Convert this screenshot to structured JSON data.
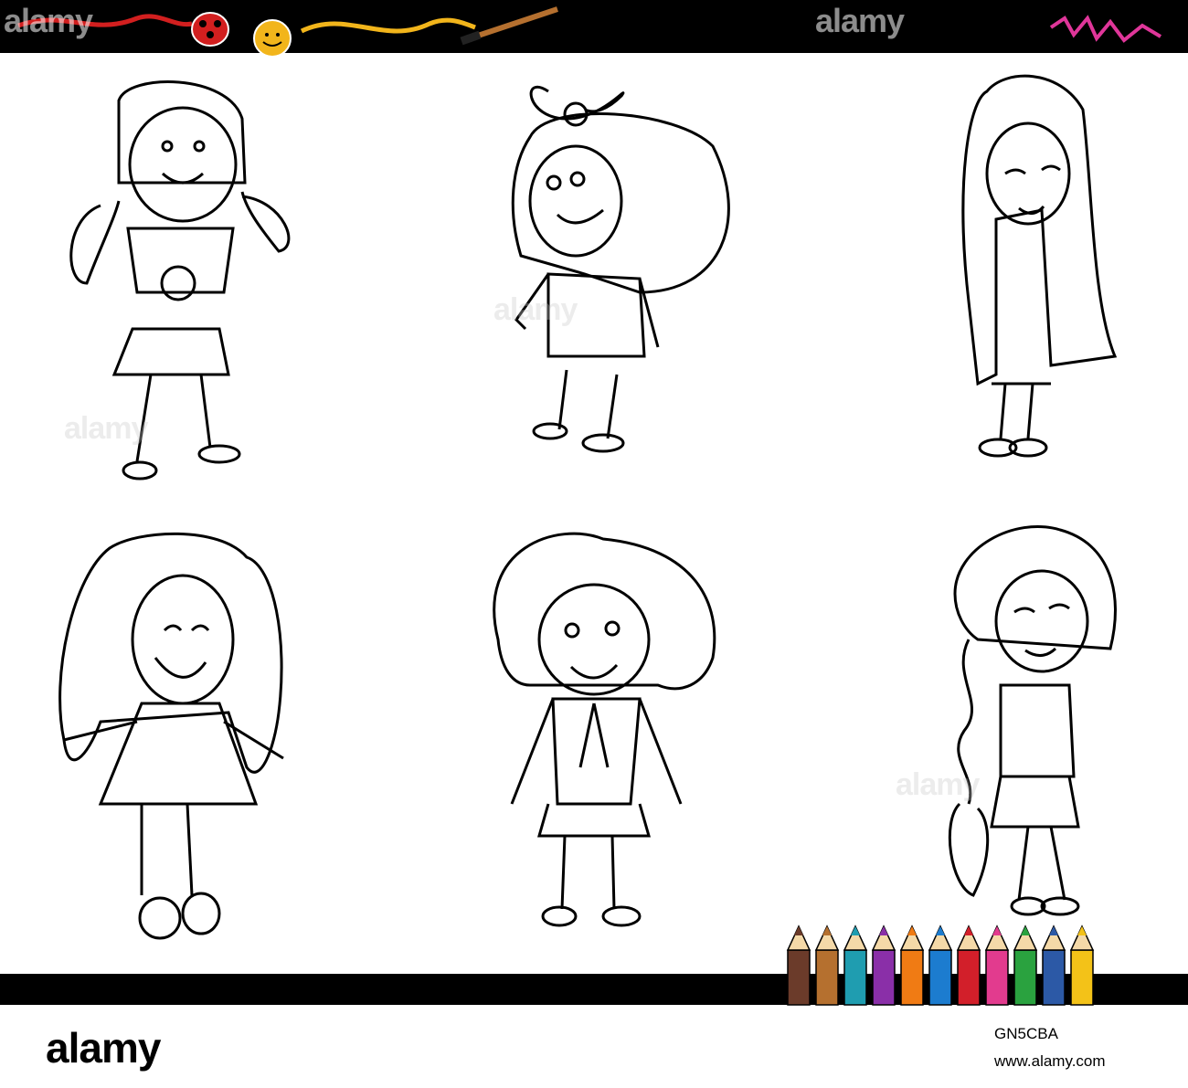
{
  "watermark": {
    "top_left": "alamy",
    "top_center": "alamy",
    "mid_1": "alamy",
    "mid_2": "alamy",
    "mid_3": "alamy"
  },
  "footer": {
    "brand": "alamy",
    "image_code": "GN5CBA",
    "site": "www.alamy.com"
  },
  "palette": {
    "band": "#000000",
    "ladybug": "#d21f1f",
    "sun": "#f2b51b",
    "magenta_scribble": "#e0369a",
    "pencils": [
      "#6b3b2a",
      "#b5702f",
      "#1f9db0",
      "#8a2fa8",
      "#f07b14",
      "#1c7ccf",
      "#d21f2a",
      "#e23b8e",
      "#2aa23f",
      "#2c59a6",
      "#f3c218"
    ]
  },
  "figures": [
    {
      "name": "girl-pigtails-flower-shirt"
    },
    {
      "name": "girl-big-bow"
    },
    {
      "name": "girl-long-straight-hair"
    },
    {
      "name": "girl-wavy-hair-dress"
    },
    {
      "name": "girl-bob-haircut-ribbon"
    },
    {
      "name": "girl-braid"
    }
  ]
}
